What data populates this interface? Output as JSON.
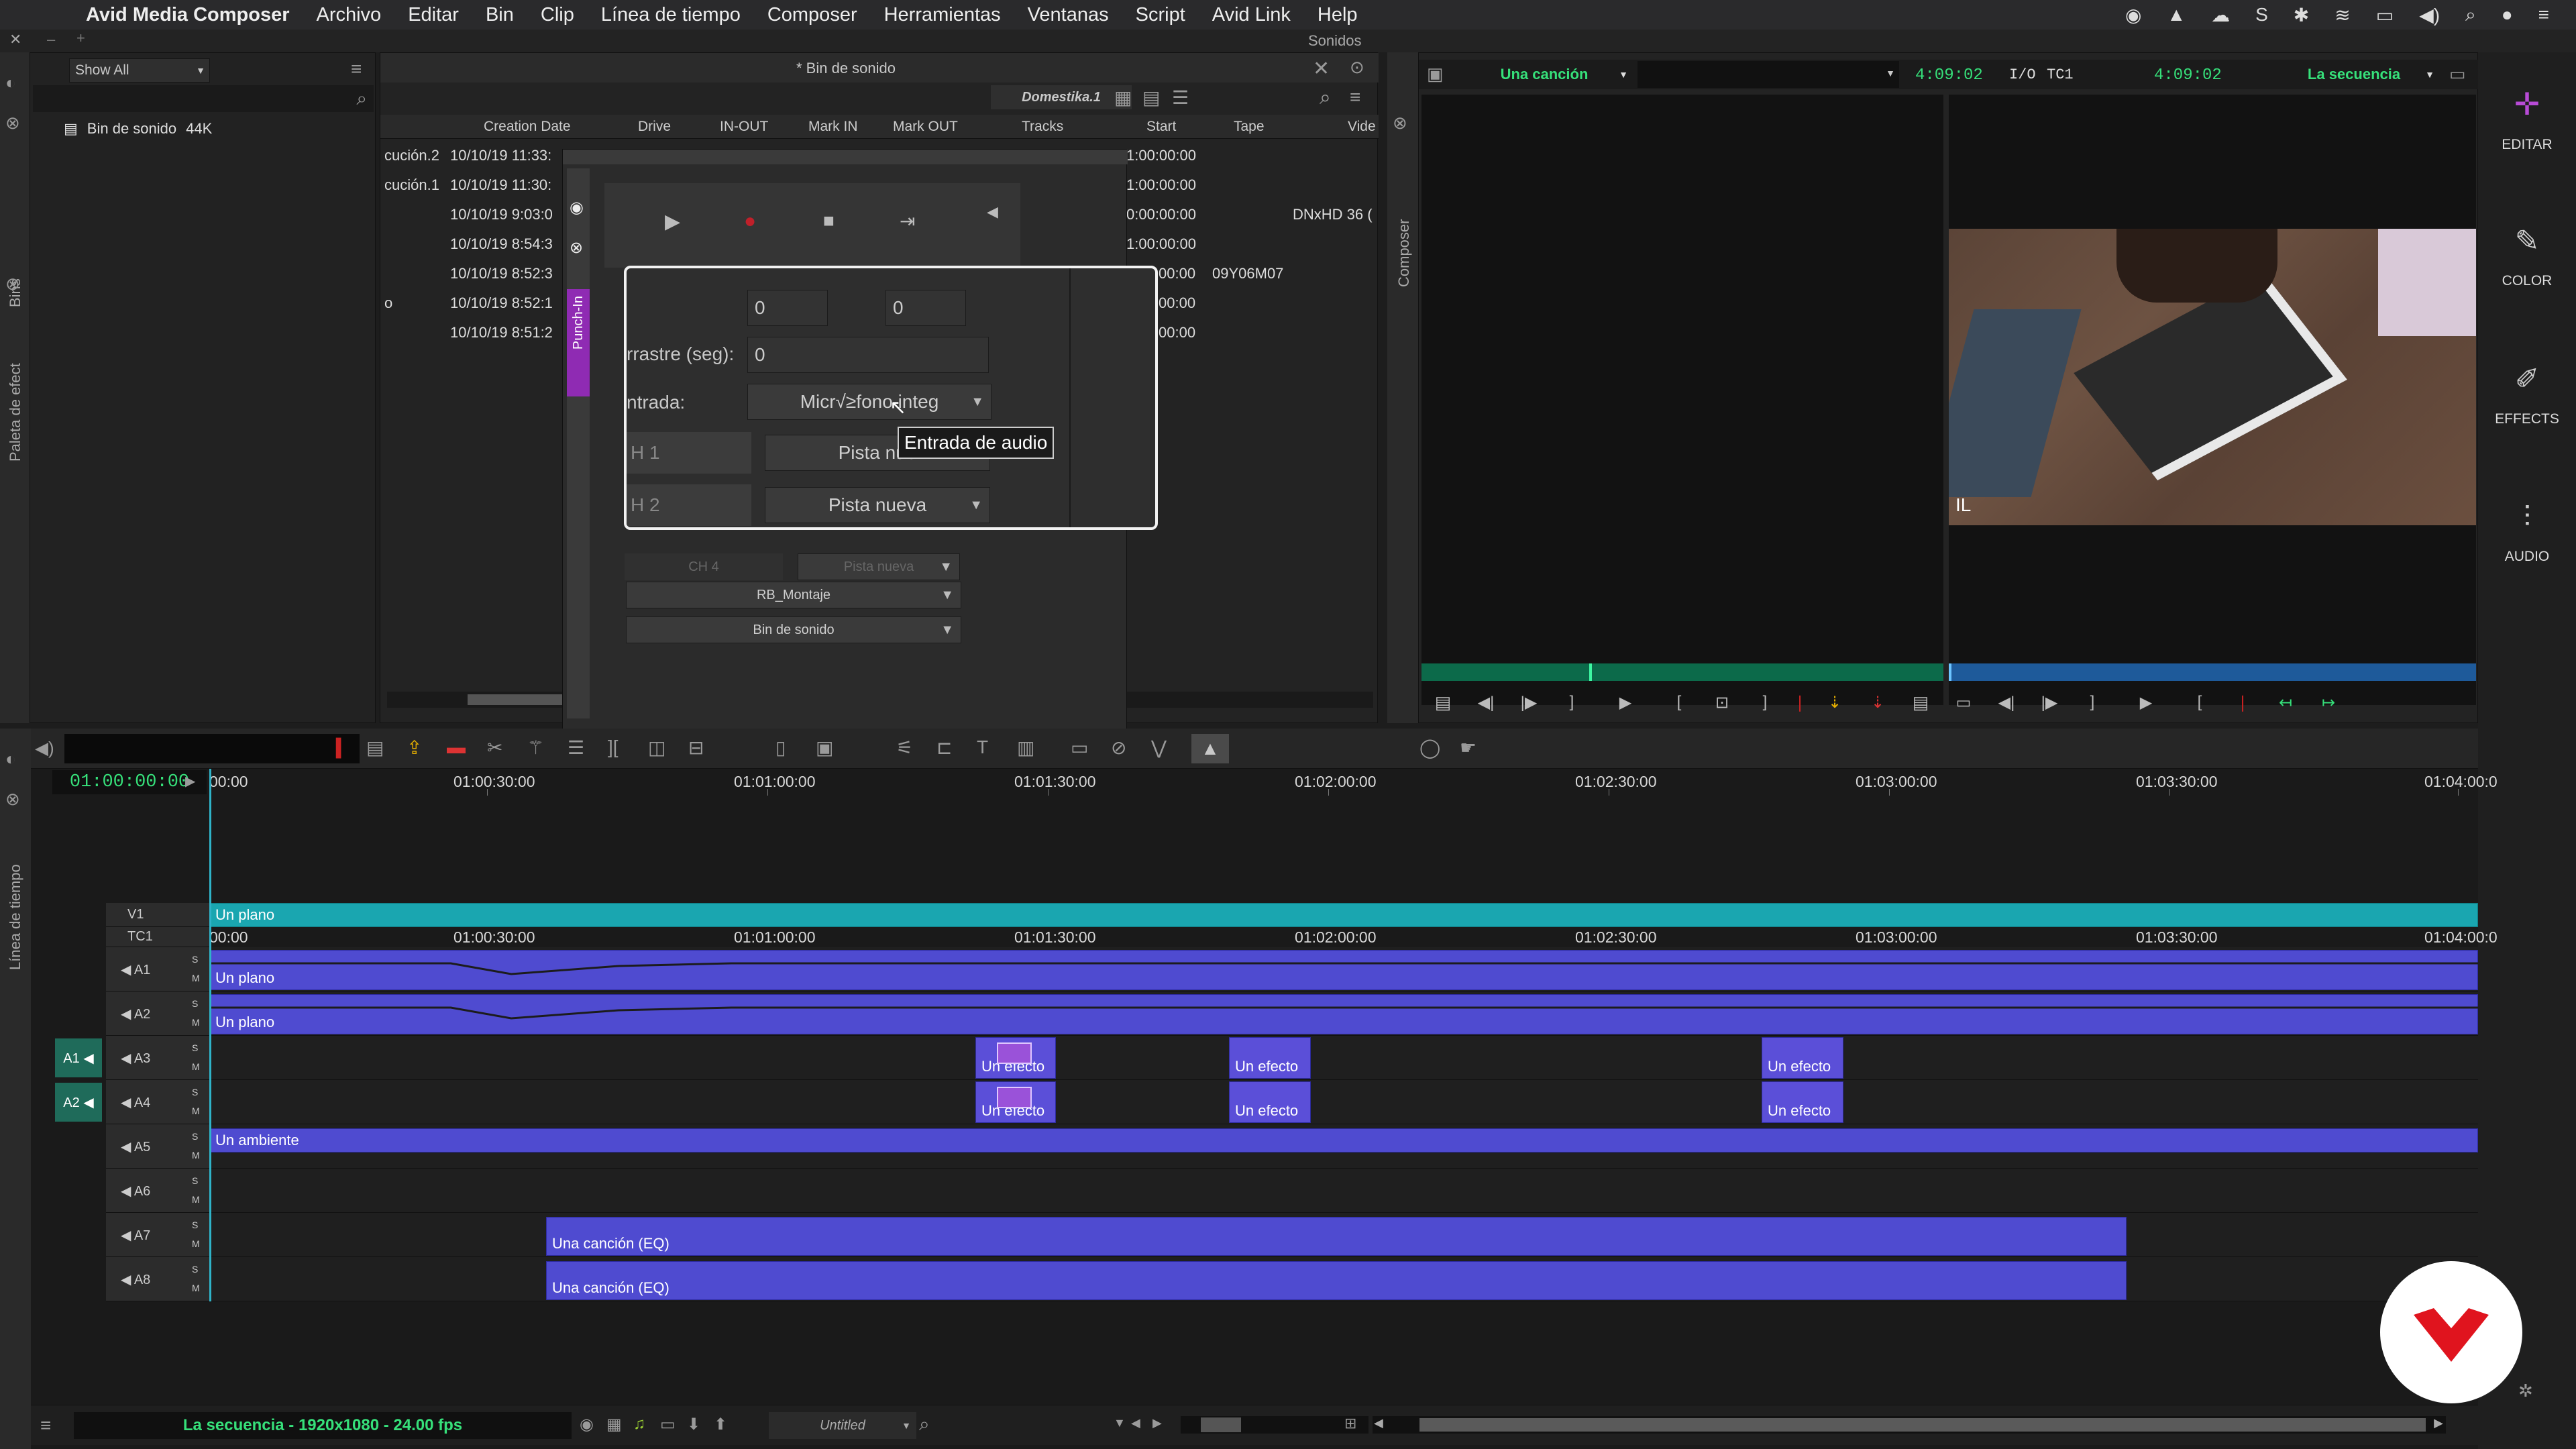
{
  "menubar": {
    "app": "Avid Media Composer",
    "items": [
      "Archivo",
      "Editar",
      "Bin",
      "Clip",
      "Línea de tiempo",
      "Composer",
      "Herramientas",
      "Ventanas",
      "Script",
      "Avid Link",
      "Help"
    ]
  },
  "window": {
    "title": "Sonidos"
  },
  "bins_panel": {
    "tab_label": "Bins",
    "filter": "Show All",
    "bin_name": "Bin de sonido",
    "bin_size": "44K"
  },
  "effect_palette_tab": "Paleta de efect",
  "timeline_tab": "Línea de tiempo",
  "bin_window": {
    "title": "* Bin de sonido",
    "view_name": "Domestika.1",
    "columns": [
      "Creation Date",
      "Drive",
      "IN-OUT",
      "Mark IN",
      "Mark OUT",
      "Tracks",
      "Start",
      "Tape",
      "Vide"
    ],
    "rows": [
      {
        "name": "cución.2",
        "date": "10/10/19 11:33:",
        "start": "1:00:00:00",
        "tape": "",
        "video": ""
      },
      {
        "name": "cución.1",
        "date": "10/10/19 11:30:",
        "start": "1:00:00:00",
        "tape": "",
        "video": ""
      },
      {
        "name": "",
        "date": "10/10/19 9:03:0",
        "start": "0:00:00:00",
        "tape": "",
        "video": "DNxHD 36 ("
      },
      {
        "name": "",
        "date": "10/10/19 8:54:3",
        "start": "1:00:00:00",
        "tape": "",
        "video": ""
      },
      {
        "name": "",
        "date": "10/10/19 8:52:3",
        "start": "00:00",
        "tape": "09Y06M07",
        "video": ""
      },
      {
        "name": "o",
        "date": "10/10/19 8:52:1",
        "start": "00:00",
        "tape": "",
        "video": ""
      },
      {
        "name": "",
        "date": "10/10/19 8:51:2",
        "start": "00:00",
        "tape": "",
        "video": ""
      }
    ]
  },
  "punch_in": {
    "tab_label": "Punch-In",
    "field1": "0",
    "field2": "0",
    "preroll_label": "rrastre (seg):",
    "preroll_value": "0",
    "input_label": "ntrada:",
    "input_value": "Micr√≥fono integ",
    "tooltip": "Entrada de audio",
    "ch1_label": "H 1",
    "ch1_value": "Pista nue",
    "ch2_label": "H 2",
    "ch2_value": "Pista nueva",
    "ch4_label": "CH 4",
    "ch4_value": "Pista nueva",
    "target1": "RB_Montaje",
    "target2": "Bin de sonido"
  },
  "composer": {
    "tab_label": "Composer",
    "source_name": "Una canción",
    "source_tc": "4:09:02",
    "io_label": "I/O",
    "tc_label": "TC1",
    "record_tc": "4:09:02",
    "record_name": "La secuencia",
    "frame_overlay": "IL"
  },
  "right_toolbar": [
    {
      "label": "EDITAR",
      "icon": "edit-icon",
      "color": "#b84bd6"
    },
    {
      "label": "COLOR",
      "icon": "brush-icon",
      "color": "#cccccc"
    },
    {
      "label": "EFFECTS",
      "icon": "magic-wand-icon",
      "color": "#cccccc"
    },
    {
      "label": "AUDIO",
      "icon": "waveform-icon",
      "color": "#cccccc"
    }
  ],
  "timeline": {
    "timecode": "01:00:00:00",
    "ruler_top": [
      "00:00",
      "01:00:30:00",
      "01:01:00:00",
      "01:01:30:00",
      "01:02:00:00",
      "01:02:30:00",
      "01:03:00:00",
      "01:03:30:00",
      "01:04:00:0"
    ],
    "ruler_tc1": [
      "00:00",
      "01:00:30:00",
      "01:01:00:00",
      "01:01:30:00",
      "01:02:00:00",
      "01:02:30:00",
      "01:03:00:00",
      "01:03:30:00",
      "01:04:00:0"
    ],
    "tracks": [
      "V1",
      "TC1",
      "A1",
      "A2",
      "A3",
      "A4",
      "A5",
      "A6",
      "A7",
      "A8"
    ],
    "source_tracks": [
      "A1",
      "A2"
    ],
    "clips": {
      "v1": "Un plano",
      "a1": "Un plano",
      "a2": "Un plano",
      "a3_fx1": "Un efecto",
      "a3_fx2": "Un efecto",
      "a3_fx3": "Un efecto",
      "a4_fx1": "Un efecto",
      "a4_fx2": "Un efecto",
      "a4_fx3": "Un efecto",
      "a5": "Un ambiente",
      "a7": "Una canción (EQ)",
      "a8": "Una canción (EQ)"
    },
    "sequence_info": "La secuencia - 1920x1080 - 24.00 fps",
    "project": "Untitled"
  },
  "colors": {
    "audio_clip": "#4f4bd0",
    "video_clip": "#1aa6b0",
    "accent_green": "#36e07a",
    "brand_red": "#e0141e"
  }
}
